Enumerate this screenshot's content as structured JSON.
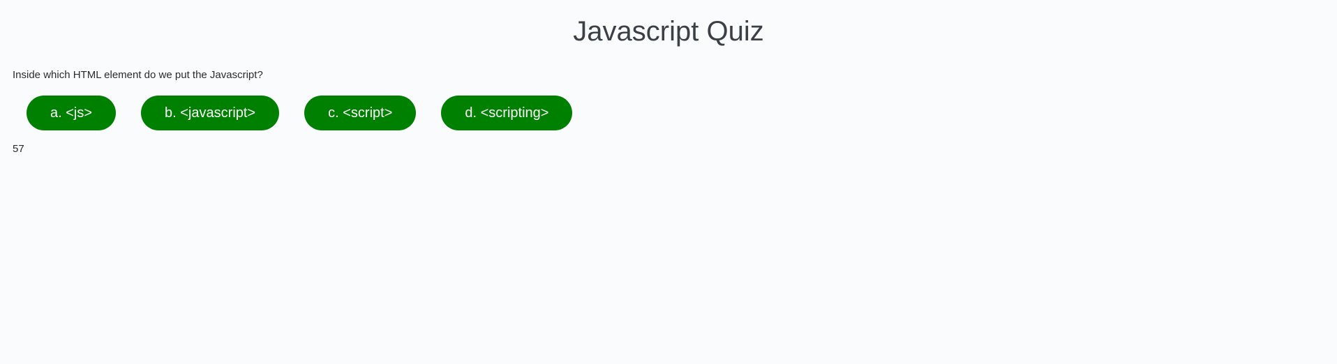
{
  "header": {
    "title": "Javascript Quiz"
  },
  "quiz": {
    "question": "Inside which HTML element do we put the Javascript?",
    "answers": [
      {
        "label": "a. <js>"
      },
      {
        "label": "b. <javascript>"
      },
      {
        "label": "c. <script>"
      },
      {
        "label": "d. <scripting>"
      }
    ],
    "timer": "57"
  },
  "colors": {
    "button_background": "#008000",
    "button_text": "#ffffff",
    "page_background": "#f9fbfd",
    "title_text": "#3b4046"
  }
}
